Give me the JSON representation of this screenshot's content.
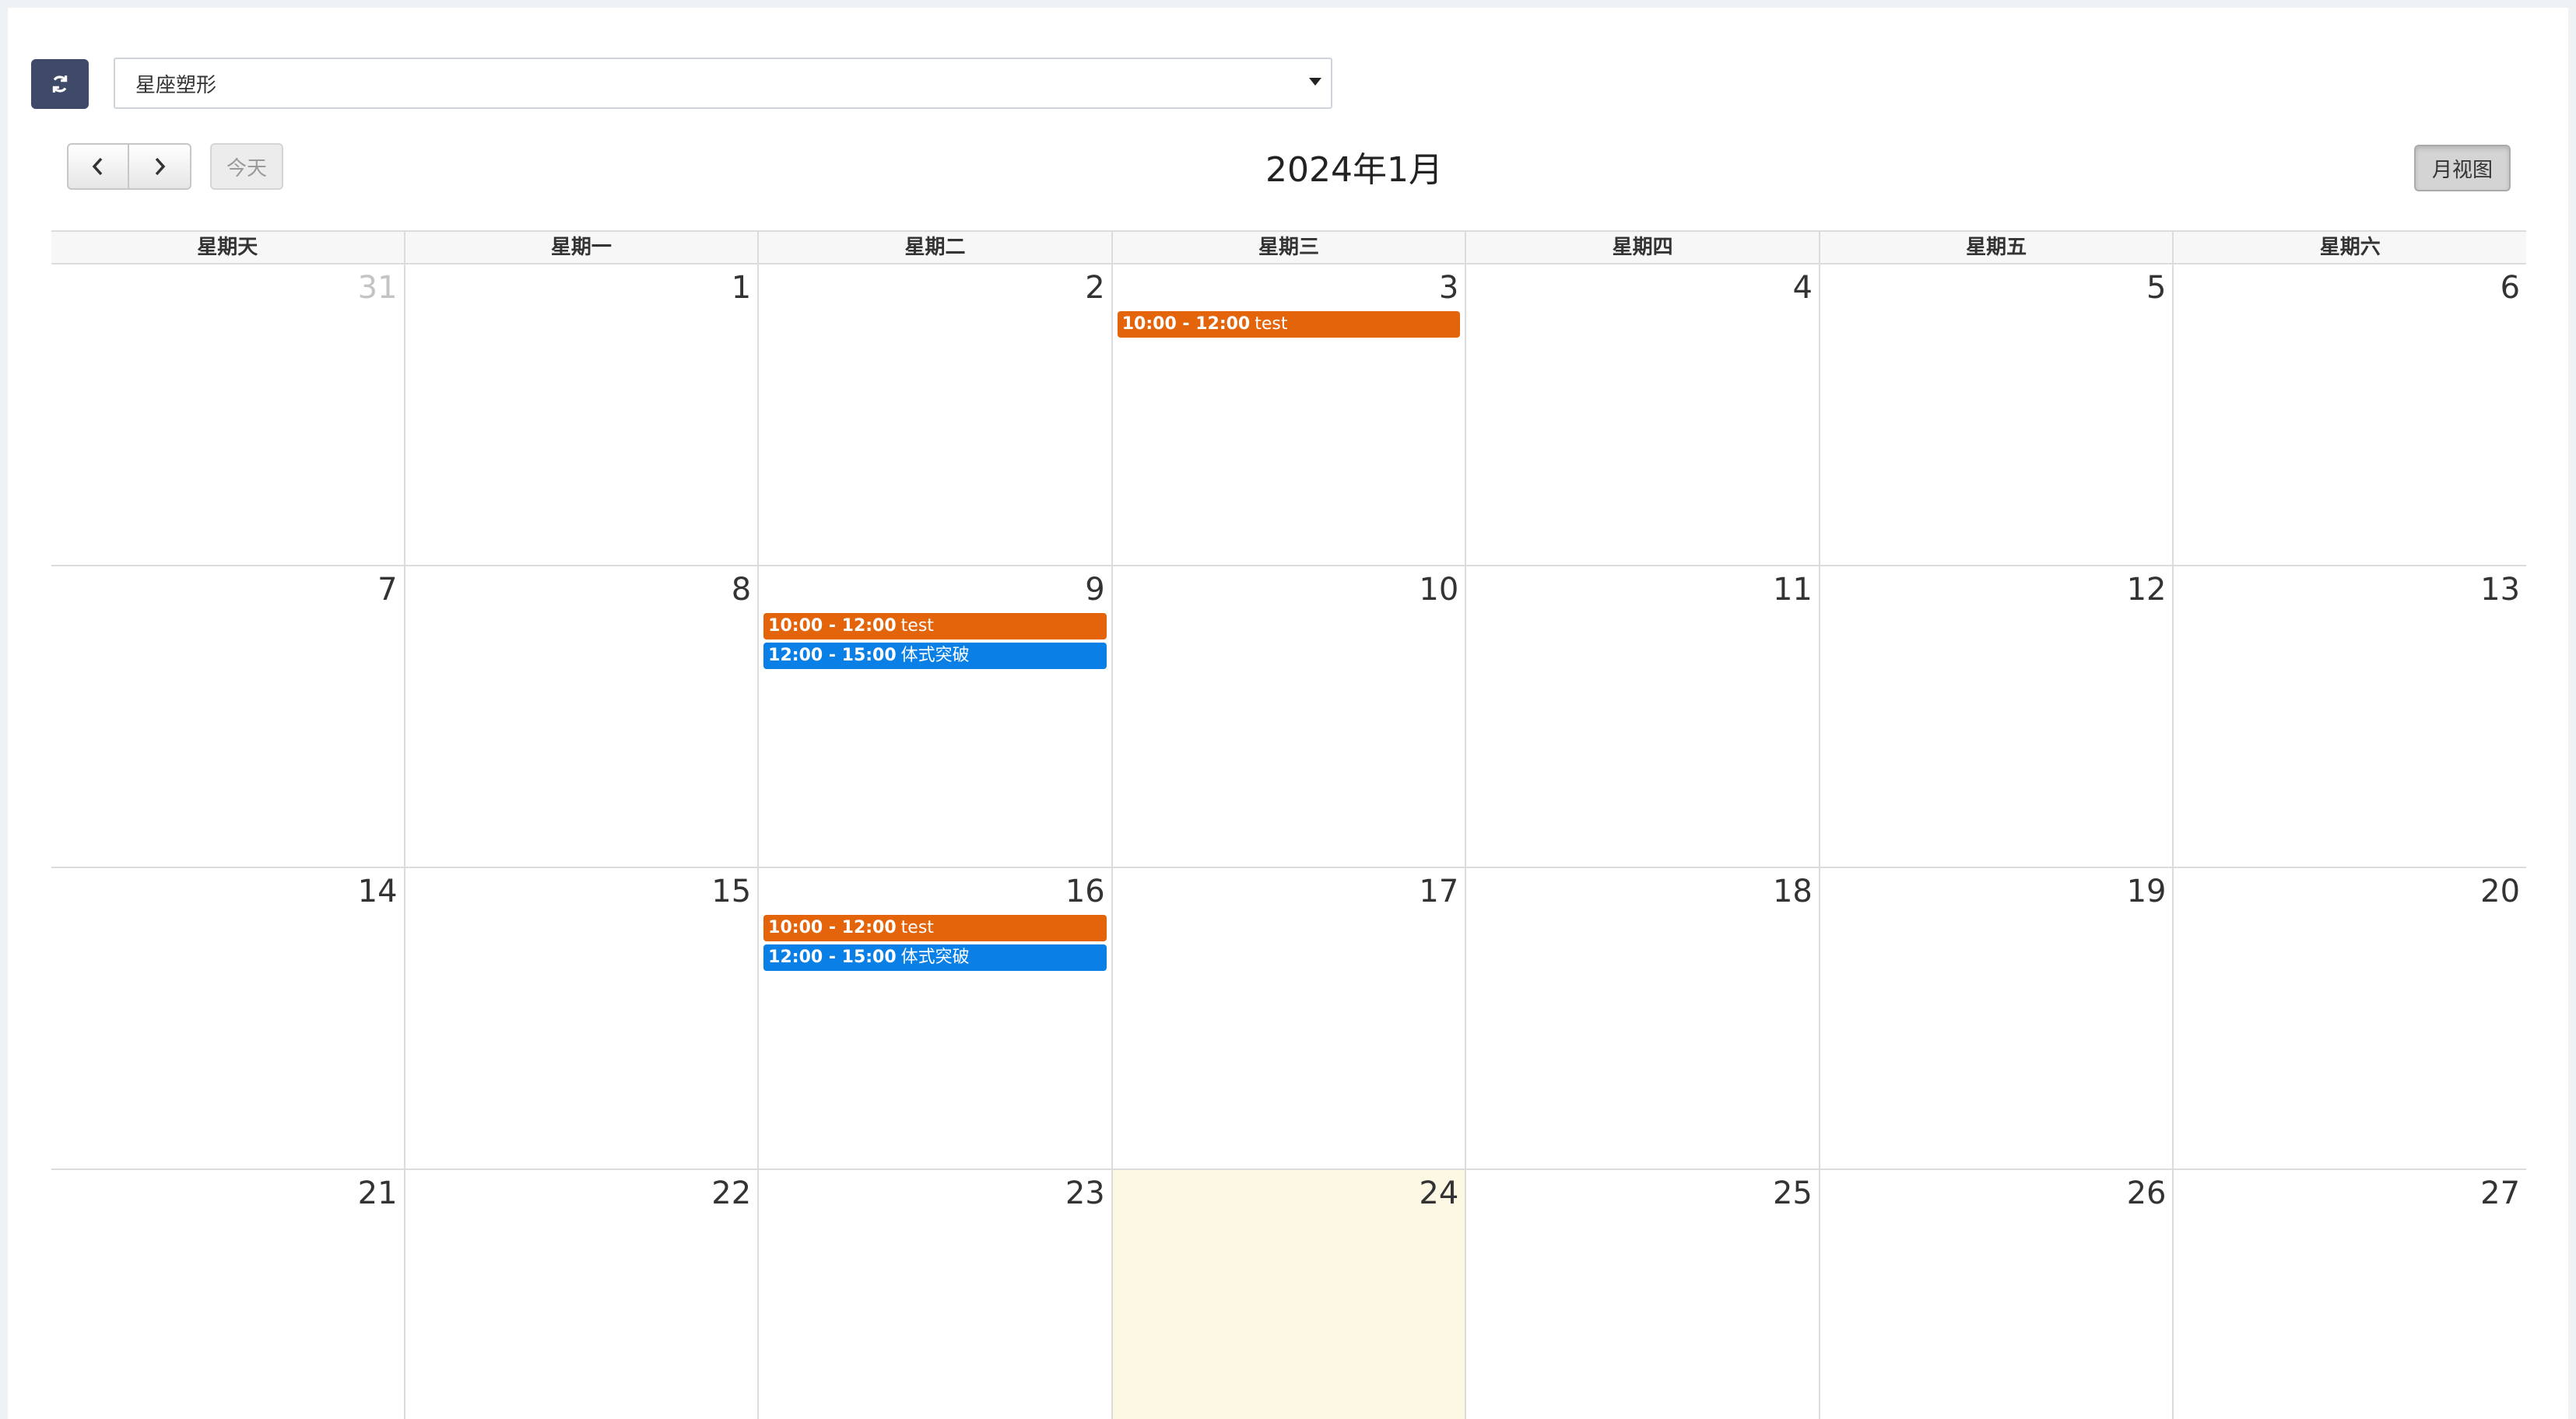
{
  "filter": {
    "selected": "星座塑形"
  },
  "toolbar": {
    "today_label": "今天",
    "title": "2024年1月",
    "view_label": "月视图"
  },
  "colors": {
    "accent": "#3f4a68",
    "event_orange": "#e3640a",
    "event_blue": "#0a7fe6",
    "today_bg": "#fcf8e3"
  },
  "weekdays": [
    "星期天",
    "星期一",
    "星期二",
    "星期三",
    "星期四",
    "星期五",
    "星期六"
  ],
  "weeks": [
    [
      {
        "day": "31",
        "other_month": true,
        "events": []
      },
      {
        "day": "1",
        "events": []
      },
      {
        "day": "2",
        "events": []
      },
      {
        "day": "3",
        "events": [
          {
            "time": "10:00 - 12:00",
            "title": "test",
            "color": "#e3640a"
          }
        ]
      },
      {
        "day": "4",
        "events": []
      },
      {
        "day": "5",
        "events": []
      },
      {
        "day": "6",
        "events": []
      }
    ],
    [
      {
        "day": "7",
        "events": []
      },
      {
        "day": "8",
        "events": []
      },
      {
        "day": "9",
        "events": [
          {
            "time": "10:00 - 12:00",
            "title": "test",
            "color": "#e3640a"
          },
          {
            "time": "12:00 - 15:00",
            "title": "体式突破",
            "color": "#0a7fe6"
          }
        ]
      },
      {
        "day": "10",
        "events": []
      },
      {
        "day": "11",
        "events": []
      },
      {
        "day": "12",
        "events": []
      },
      {
        "day": "13",
        "events": []
      }
    ],
    [
      {
        "day": "14",
        "events": []
      },
      {
        "day": "15",
        "events": []
      },
      {
        "day": "16",
        "events": [
          {
            "time": "10:00 - 12:00",
            "title": "test",
            "color": "#e3640a"
          },
          {
            "time": "12:00 - 15:00",
            "title": "体式突破",
            "color": "#0a7fe6"
          }
        ]
      },
      {
        "day": "17",
        "events": []
      },
      {
        "day": "18",
        "events": []
      },
      {
        "day": "19",
        "events": []
      },
      {
        "day": "20",
        "events": []
      }
    ],
    [
      {
        "day": "21",
        "events": []
      },
      {
        "day": "22",
        "events": []
      },
      {
        "day": "23",
        "events": []
      },
      {
        "day": "24",
        "today": true,
        "events": []
      },
      {
        "day": "25",
        "events": []
      },
      {
        "day": "26",
        "events": []
      },
      {
        "day": "27",
        "events": []
      }
    ]
  ]
}
